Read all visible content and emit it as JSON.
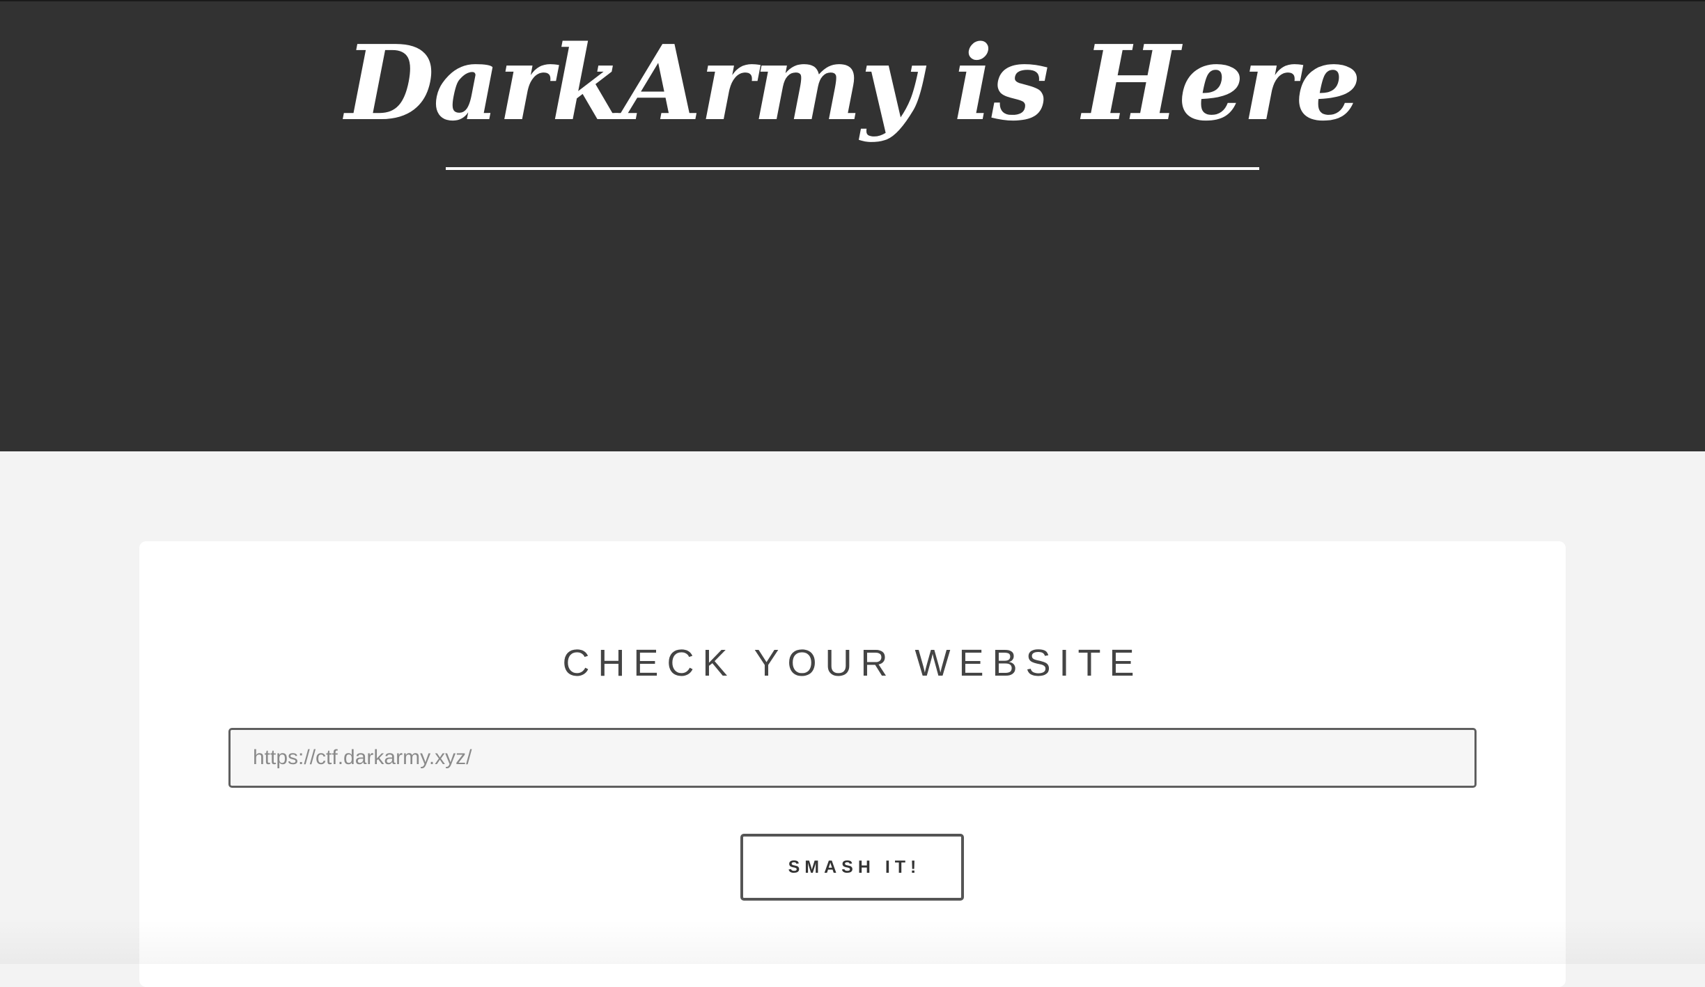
{
  "header": {
    "title": "DarkArmy is Here"
  },
  "main": {
    "section_title": "CHECK YOUR WEBSITE",
    "url_input": {
      "value": "",
      "placeholder": "https://ctf.darkarmy.xyz/"
    },
    "submit_label": "SMASH IT!"
  },
  "colors": {
    "hero_background": "#323232",
    "page_background": "#f3f3f3",
    "card_background": "#ffffff",
    "text_dark": "#444444"
  }
}
